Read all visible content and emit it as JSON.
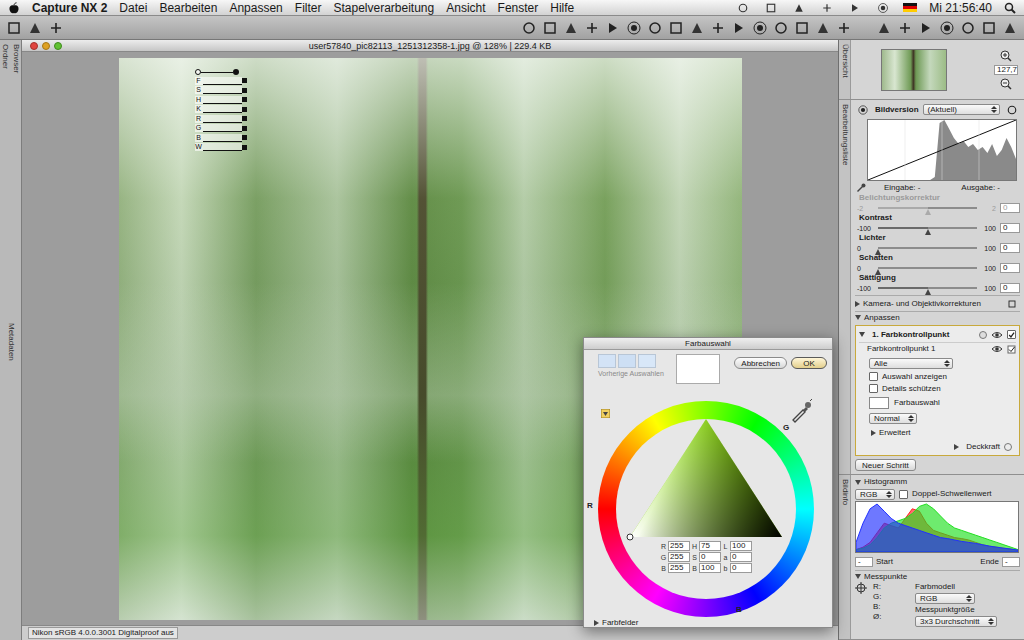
{
  "menubar": {
    "app": "Capture NX 2",
    "menus": [
      "Datei",
      "Bearbeiten",
      "Anpassen",
      "Filter",
      "Stapelverarbeitung",
      "Ansicht",
      "Fenster",
      "Hilfe"
    ],
    "clock": "Mi 21:56:40"
  },
  "side_tabs": [
    "Ordner",
    "Browser",
    "Metadaten"
  ],
  "document": {
    "title": "user57840_pic82113_1251312358-1.jpg @ 128% | 229.4 KB",
    "control_point": {
      "sliders": [
        "F",
        "S",
        "H",
        "K",
        "R",
        "G",
        "B",
        "W"
      ]
    },
    "status": "Nikon sRGB 4.0.0.3001 Digitalproof aus"
  },
  "overview": {
    "label": "Übersicht",
    "zoom": "127,7"
  },
  "edit_list": {
    "label": "Bearbeitungsliste",
    "version_label": "Bildversion",
    "version": "(Aktuell)",
    "tone_histogram": [
      0,
      0,
      0,
      0,
      0,
      0,
      0,
      0,
      0,
      0,
      0,
      0,
      0,
      0,
      5,
      95,
      100,
      85,
      70,
      60,
      65,
      55,
      60,
      50,
      55,
      45,
      60,
      40,
      50,
      70,
      55,
      35
    ],
    "input": "Eingabe: -",
    "output": "Ausgabe: -",
    "sliders": [
      {
        "name": "Belichtungskorrektur",
        "min": "-2",
        "max": "2",
        "value": "0",
        "level": 0.5,
        "disabled": true
      },
      {
        "name": "Kontrast",
        "min": "-100",
        "max": "100",
        "value": "0",
        "level": 0.5,
        "disabled": false
      },
      {
        "name": "Lichter",
        "min": "0",
        "max": "100",
        "value": "0",
        "level": 0,
        "disabled": false
      },
      {
        "name": "Schatten",
        "min": "0",
        "max": "100",
        "value": "0",
        "level": 0,
        "disabled": false
      },
      {
        "name": "Sättigung",
        "min": "-100",
        "max": "100",
        "value": "0",
        "level": 0.5,
        "disabled": false
      }
    ],
    "camera_section": {
      "label": "Kamera- und Objektivkorrekturen",
      "expanded": false
    },
    "adjust_section": {
      "label": "Anpassen",
      "expanded": true
    },
    "step": {
      "label": "1. Farbkontrollpunkt",
      "checked": true,
      "item": "Farbkontrollpunkt 1",
      "mode": "Alle",
      "options": [
        {
          "label": "Auswahl anzeigen",
          "checked": false
        },
        {
          "label": "Details schützen",
          "checked": false
        }
      ],
      "swatch_label": "Farbauswahl",
      "swatch_color": "#ffffff",
      "blend": "Normal",
      "advanced": {
        "label": "Erweitert",
        "expanded": false
      },
      "opacity": "Deckkraft"
    },
    "new_step": "Neuer Schritt"
  },
  "info": {
    "label": "Bildinfo",
    "histogram": {
      "label": "Histogramm",
      "expanded": true,
      "channel": "RGB",
      "double_threshold": {
        "label": "Doppel-Schwellenwert",
        "checked": false
      },
      "series": [
        {
          "name": "R",
          "color": "#ff2020",
          "values": [
            5,
            10,
            20,
            40,
            60,
            55,
            50,
            70,
            90,
            85,
            60,
            45,
            40,
            35,
            30,
            28,
            25,
            20,
            15,
            12,
            10,
            8,
            6,
            4
          ]
        },
        {
          "name": "G",
          "color": "#20e020",
          "values": [
            5,
            8,
            15,
            30,
            50,
            60,
            65,
            70,
            80,
            95,
            100,
            90,
            75,
            60,
            50,
            45,
            40,
            35,
            30,
            25,
            20,
            15,
            10,
            5
          ]
        },
        {
          "name": "B",
          "color": "#2030ff",
          "values": [
            20,
            60,
            90,
            100,
            85,
            70,
            60,
            55,
            50,
            45,
            40,
            35,
            30,
            28,
            25,
            22,
            20,
            18,
            15,
            12,
            10,
            8,
            6,
            4
          ]
        }
      ],
      "start_label": "Start",
      "start": "-",
      "end_label": "Ende",
      "end": "-"
    },
    "measure": {
      "label": "Messpunkte",
      "expanded": true,
      "channels": [
        "R:",
        "G:",
        "B:",
        "Ø:"
      ],
      "model_label": "Farbmodell",
      "model": "RGB",
      "size_label": "Messpunktgröße",
      "size": "3x3 Durchschnitt"
    }
  },
  "dialog": {
    "title": "Farbauswahl",
    "previous_label": "Vorherige Auswahlen",
    "previous": [
      {
        "color": "#d3e3f6"
      },
      {
        "color": "#cddff4"
      },
      {
        "color": "#d8e7f8"
      }
    ],
    "current": "#ffffff",
    "buttons": [
      {
        "label": "Abbrechen",
        "selected": false
      },
      {
        "label": "OK",
        "selected": true
      }
    ],
    "wheel_labels": [
      "R",
      "G",
      "B"
    ],
    "fields": [
      [
        {
          "label": "R",
          "value": "255"
        },
        {
          "label": "H",
          "value": "75"
        },
        {
          "label": "L",
          "value": "100"
        }
      ],
      [
        {
          "label": "G",
          "value": "255"
        },
        {
          "label": "S",
          "value": "0"
        },
        {
          "label": "a",
          "value": "0"
        }
      ],
      [
        {
          "label": "B",
          "value": "255"
        },
        {
          "label": "B",
          "value": "100"
        },
        {
          "label": "b",
          "value": "0"
        }
      ]
    ],
    "swatches": {
      "label": "Farbfelder",
      "expanded": false
    }
  }
}
